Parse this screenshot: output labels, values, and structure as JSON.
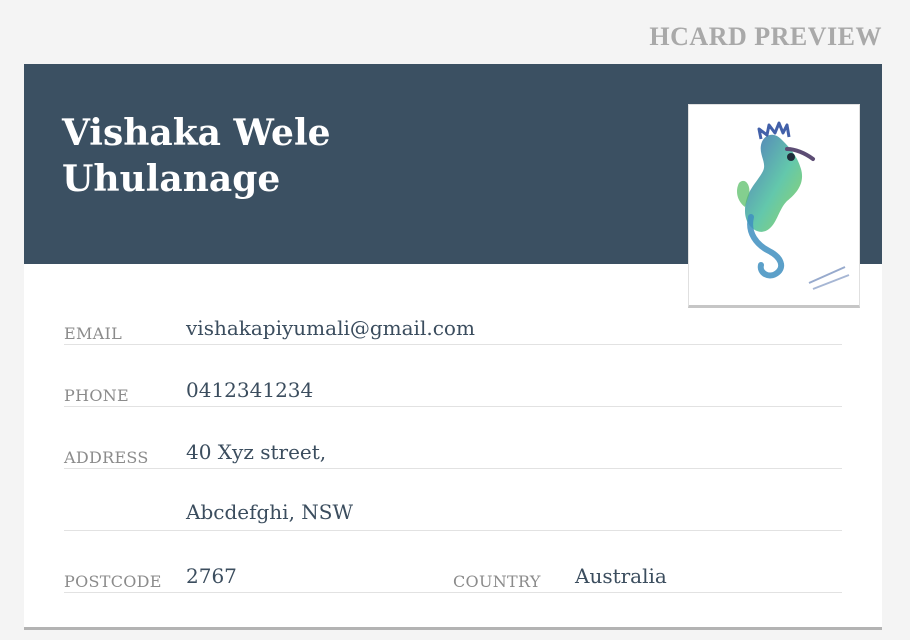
{
  "page": {
    "title": "HCARD PREVIEW"
  },
  "card": {
    "name_line1": "Vishaka Wele",
    "name_line2": "Uhulanage",
    "avatar_alt": "seahorse-watercolor-image",
    "fields": {
      "email_label": "EMAIL",
      "email_value": "vishakapiyumali@gmail.com",
      "phone_label": "PHONE",
      "phone_value": "0412341234",
      "address_label": "ADDRESS",
      "address_line1": "40 Xyz street,",
      "address_line2": "Abcdefghi, NSW",
      "postcode_label": "POSTCODE",
      "postcode_value": "2767",
      "country_label": "COUNTRY",
      "country_value": "Australia"
    }
  },
  "colors": {
    "header_bg": "#3b5062",
    "page_bg": "#f4f4f4",
    "label_text": "#8b8b8b",
    "value_text": "#3b4d5e",
    "title_text": "#a9a9a9"
  }
}
